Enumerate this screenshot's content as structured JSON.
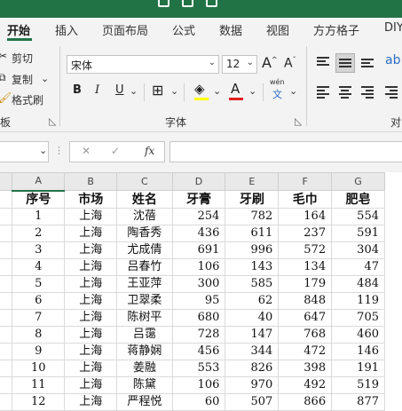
{
  "tabs": [
    "开始",
    "插入",
    "页面布局",
    "公式",
    "数据",
    "视图",
    "方方格子",
    "DIY"
  ],
  "clipboard": {
    "cut": "剪切",
    "copy": "复制",
    "format_painter": "格式刷",
    "group_label": "板"
  },
  "font": {
    "name": "宋体",
    "size": "12",
    "bold": "B",
    "italic": "I",
    "underline": "U",
    "grow": "A",
    "shrink": "A",
    "font_color": "A",
    "phonetic_top": "wén",
    "phonetic_bottom": "文",
    "group_label": "字体"
  },
  "alignment": {
    "group_label": "对"
  },
  "formula_bar": {
    "cancel": "✕",
    "enter": "✓",
    "fx": "fx",
    "value": ""
  },
  "colors": {
    "accent": "#217346",
    "highlight": "#ffff00",
    "font_color": "#e02020"
  },
  "columns": [
    "A",
    "B",
    "C",
    "D",
    "E",
    "F",
    "G"
  ],
  "header": [
    "序号",
    "市场",
    "姓名",
    "牙膏",
    "牙刷",
    "毛巾",
    "肥皂"
  ],
  "rows": [
    [
      "1",
      "上海",
      "沈蓓",
      "254",
      "782",
      "164",
      "554"
    ],
    [
      "2",
      "上海",
      "陶香秀",
      "436",
      "611",
      "237",
      "591"
    ],
    [
      "3",
      "上海",
      "尤成倩",
      "691",
      "996",
      "572",
      "304"
    ],
    [
      "4",
      "上海",
      "吕春竹",
      "106",
      "143",
      "134",
      "47"
    ],
    [
      "5",
      "上海",
      "王亚萍",
      "300",
      "585",
      "179",
      "484"
    ],
    [
      "6",
      "上海",
      "卫翠柔",
      "95",
      "62",
      "848",
      "119"
    ],
    [
      "7",
      "上海",
      "陈树平",
      "680",
      "40",
      "647",
      "705"
    ],
    [
      "8",
      "上海",
      "吕霭",
      "728",
      "147",
      "768",
      "460"
    ],
    [
      "9",
      "上海",
      "蒋静娴",
      "456",
      "344",
      "472",
      "146"
    ],
    [
      "10",
      "上海",
      "姜融",
      "553",
      "826",
      "398",
      "191"
    ],
    [
      "11",
      "上海",
      "陈黛",
      "106",
      "970",
      "492",
      "519"
    ],
    [
      "12",
      "上海",
      "严程悦",
      "60",
      "507",
      "866",
      "877"
    ]
  ]
}
